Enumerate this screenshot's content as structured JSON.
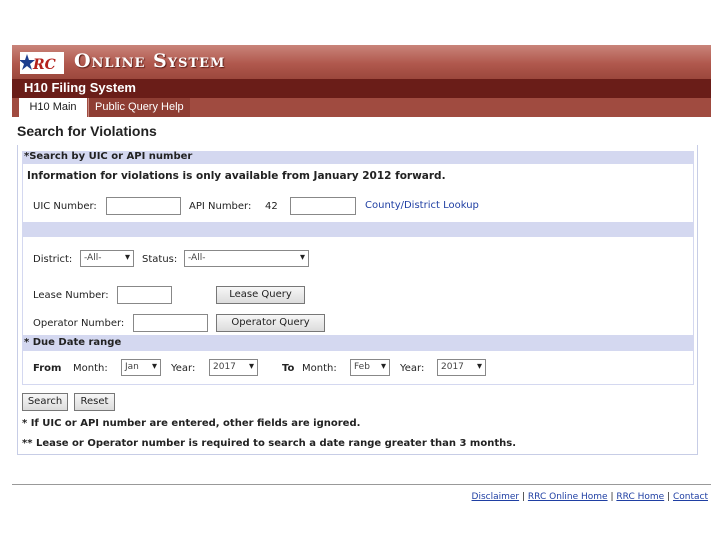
{
  "header": {
    "banner_title": "Online System",
    "logo_text": "RRC",
    "subtitle": "H10 Filing System"
  },
  "tabs": [
    {
      "label": "H10 Main",
      "active": true
    },
    {
      "label": "Public Query Help",
      "active": false
    }
  ],
  "page": {
    "title": "Search for Violations"
  },
  "section1": {
    "heading": "*Search by UIC or API number",
    "info": "Information for violations is only available from January 2012 forward.",
    "uic_label": "UIC Number:",
    "uic_value": "",
    "api_label": "API Number:",
    "api_prefix": "42",
    "api_value": "",
    "county_link": "County/District Lookup"
  },
  "section2": {
    "district_label": "District:",
    "district_value": "-All-",
    "status_label": "Status:",
    "status_value": "-All-",
    "lease_label": "Lease Number:",
    "lease_value": "",
    "lease_button": "Lease Query",
    "operator_label": "Operator Number:",
    "operator_value": "",
    "operator_button": "Operator Query"
  },
  "section3": {
    "heading": "* Due Date range",
    "from_label": "From",
    "from_month_label": "Month:",
    "from_month": "Jan",
    "from_year_label": "Year:",
    "from_year": "2017",
    "to_label": "To",
    "to_month_label": "Month:",
    "to_month": "Feb",
    "to_year_label": "Year:",
    "to_year": "2017"
  },
  "actions": {
    "search": "Search",
    "reset": "Reset"
  },
  "notes": {
    "note1": "* If UIC or API number are entered, other fields are ignored.",
    "note2": "** Lease or Operator number is required to search a date range greater than 3 months."
  },
  "footer": {
    "disclaimer": "Disclaimer",
    "rrc_online_home": "RRC Online Home",
    "rrc_home": "RRC Home",
    "contact": "Contact",
    "separator": "|"
  },
  "colors": {
    "banner": "#b0584d",
    "subheader": "#6a1d18",
    "tabbar": "#a04b40",
    "section_band": "#d4d8f0",
    "link": "#1f3fa3"
  }
}
